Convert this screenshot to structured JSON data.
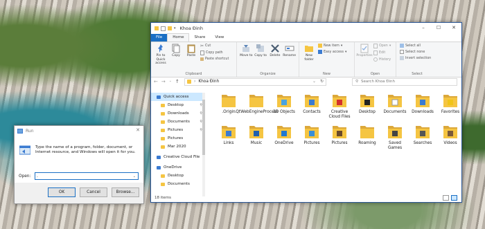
{
  "explorer": {
    "title": "Khoa Đinh",
    "tabs": [
      "File",
      "Home",
      "Share",
      "View"
    ],
    "ribbon": {
      "clipboard": {
        "label": "Clipboard",
        "pin": "Pin to Quick access",
        "copy": "Copy",
        "paste": "Paste",
        "cut": "Cut",
        "copy_path": "Copy path",
        "paste_shortcut": "Paste shortcut"
      },
      "organize": {
        "label": "Organize",
        "move_to": "Move to",
        "copy_to": "Copy to",
        "delete": "Delete",
        "rename": "Rename"
      },
      "new": {
        "label": "New",
        "new_folder": "New folder",
        "new_item": "New item",
        "easy_access": "Easy access"
      },
      "open": {
        "label": "Open",
        "properties": "Properties",
        "open": "Open",
        "edit": "Edit",
        "history": "History"
      },
      "select": {
        "label": "Select",
        "select_all": "Select all",
        "select_none": "Select none",
        "invert": "Invert selection"
      }
    },
    "address": {
      "path": "Khoa Đinh",
      "search_placeholder": "Search Khoa Đinh"
    },
    "nav": [
      {
        "label": "Quick access",
        "kind": "quick",
        "selected": true
      },
      {
        "label": "Desktop",
        "kind": "sub",
        "pinned": true
      },
      {
        "label": "Downloads",
        "kind": "sub",
        "pinned": true
      },
      {
        "label": "Documents",
        "kind": "sub",
        "pinned": true
      },
      {
        "label": "Pictures",
        "kind": "sub",
        "pinned": true
      },
      {
        "label": "Pictures",
        "kind": "sub"
      },
      {
        "label": "Mar 2020",
        "kind": "sub"
      },
      {
        "label": "Creative Cloud File",
        "kind": "top"
      },
      {
        "label": "OneDrive",
        "kind": "top"
      },
      {
        "label": "Desktop",
        "kind": "sub"
      },
      {
        "label": "Documents",
        "kind": "sub"
      }
    ],
    "items": [
      {
        "label": ".Origin",
        "badge": "none"
      },
      {
        "label": ".QtWebEngineProcess",
        "badge": "none"
      },
      {
        "label": "3D Objects",
        "badge": "cube"
      },
      {
        "label": "Contacts",
        "badge": "contact"
      },
      {
        "label": "Creative Cloud Files",
        "badge": "cc"
      },
      {
        "label": "Desktop",
        "badge": "desktop"
      },
      {
        "label": "Documents",
        "badge": "doc"
      },
      {
        "label": "Downloads",
        "badge": "download"
      },
      {
        "label": "Favorites",
        "badge": "star"
      },
      {
        "label": "Links",
        "badge": "link"
      },
      {
        "label": "Music",
        "badge": "music"
      },
      {
        "label": "OneDrive",
        "badge": "cloud"
      },
      {
        "label": "Pictures",
        "badge": "pictures"
      },
      {
        "label": "Pictures",
        "badge": "pictures2"
      },
      {
        "label": "Roaming",
        "badge": "none"
      },
      {
        "label": "Saved Games",
        "badge": "games"
      },
      {
        "label": "Searches",
        "badge": "search"
      },
      {
        "label": "Videos",
        "badge": "video"
      }
    ],
    "status": "18 items"
  },
  "run": {
    "title": "Run",
    "description": "Type the name of a program, folder, document, or Internet resource, and Windows will open it for you.",
    "open_label": "Open:",
    "input_value": ".",
    "ok": "OK",
    "cancel": "Cancel",
    "browse": "Browse..."
  },
  "colors": {
    "accent": "#1a6fc4",
    "folder": "#f5c542"
  }
}
